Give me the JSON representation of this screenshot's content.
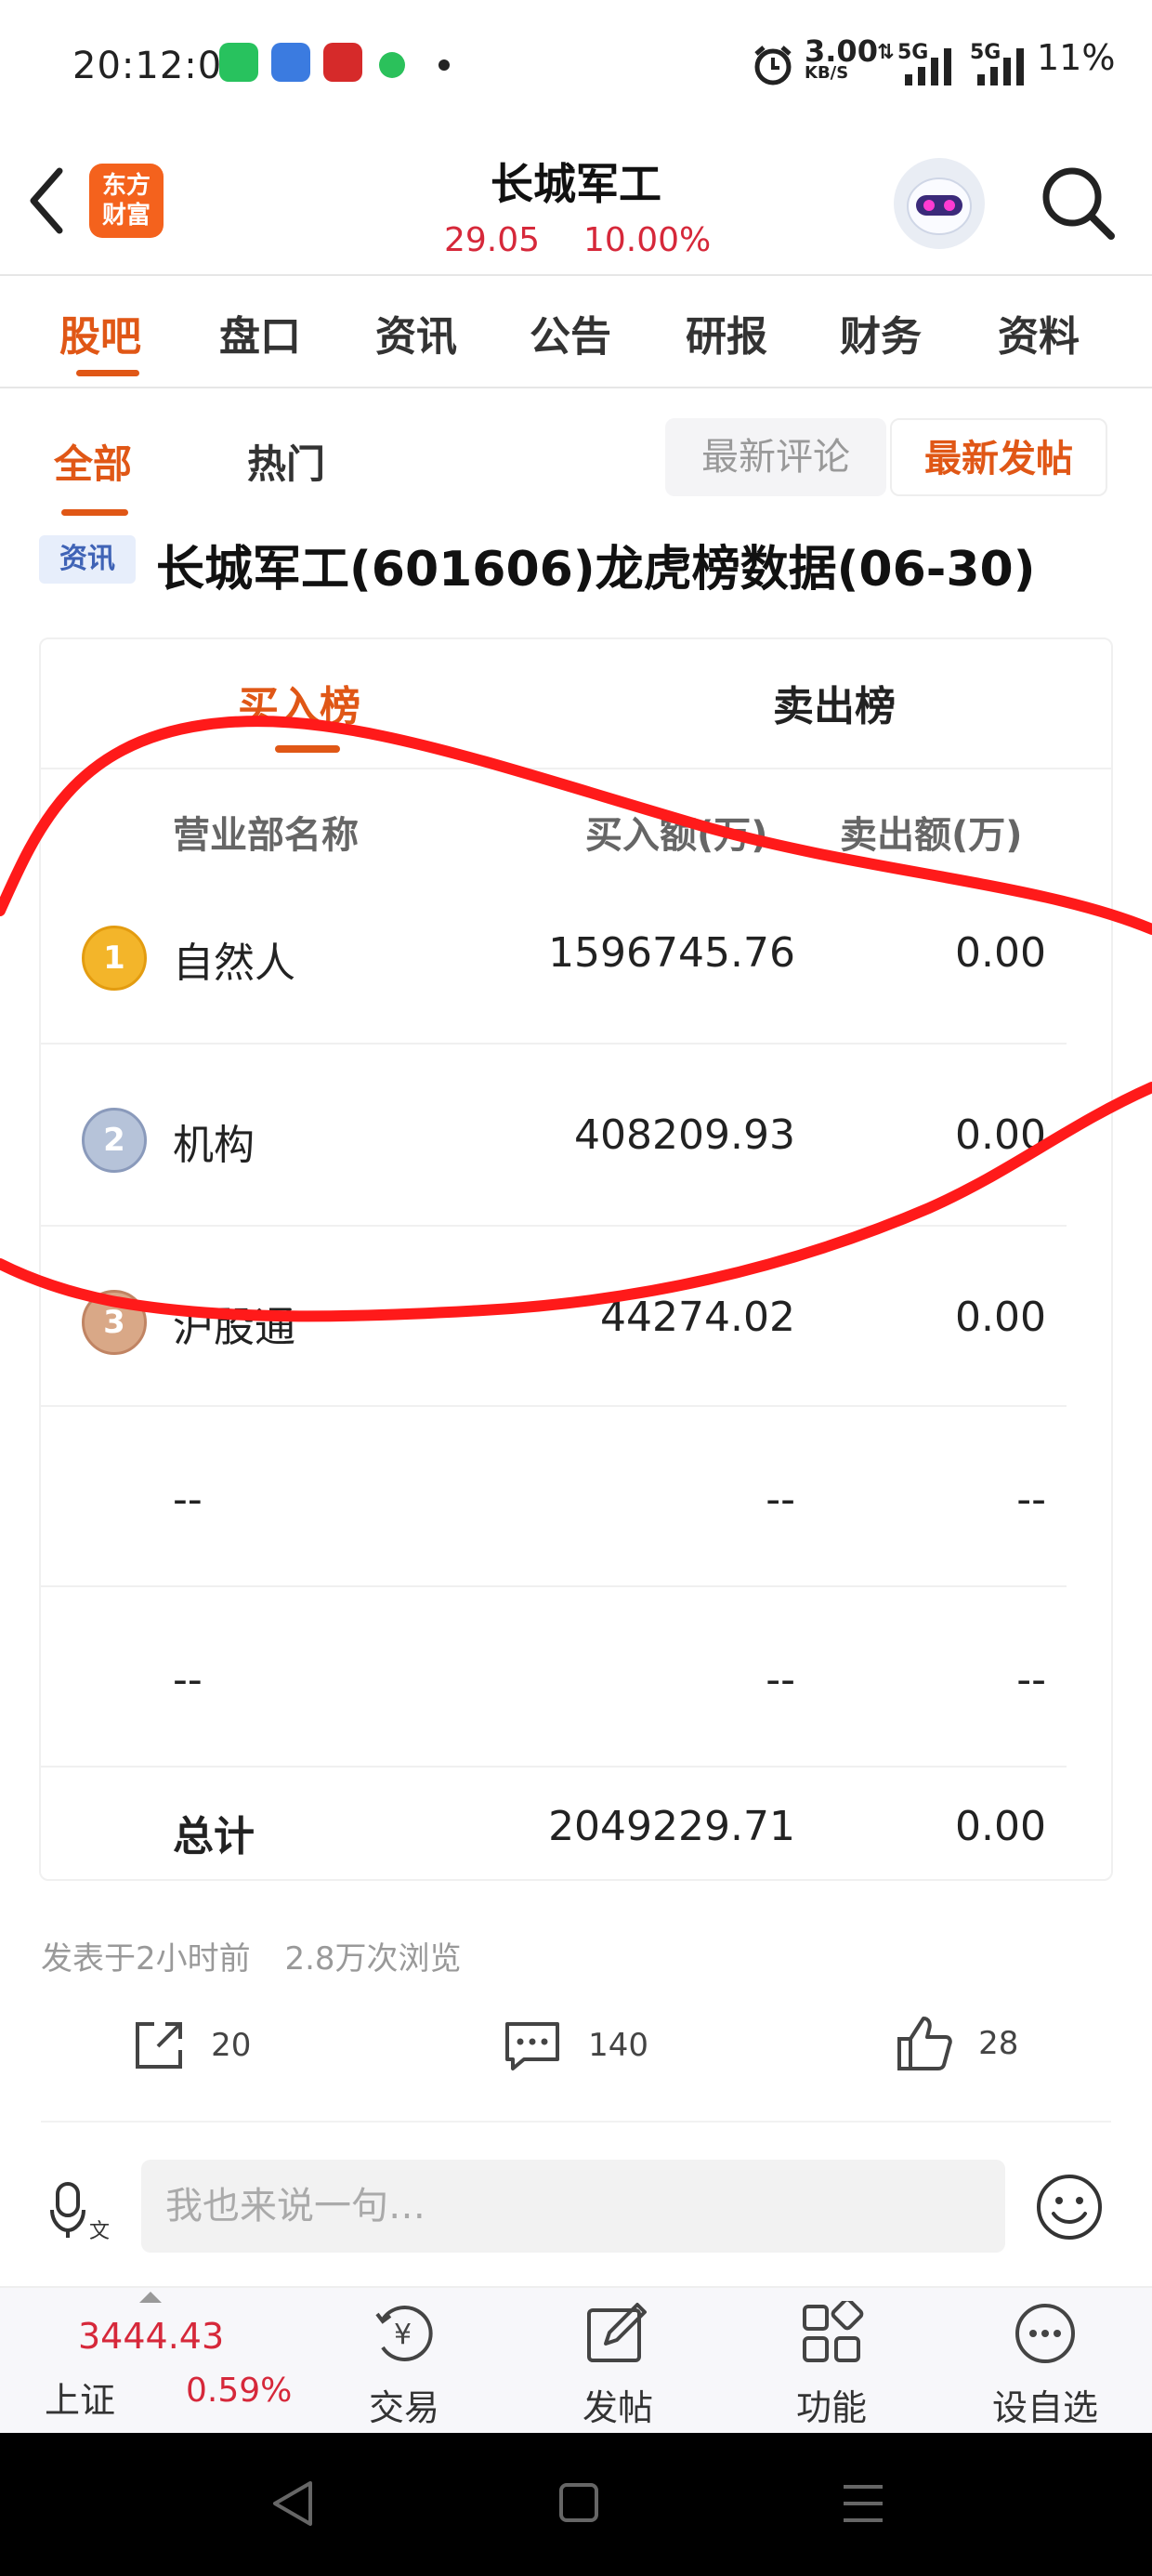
{
  "status_bar": {
    "time": "20:12:06",
    "speed_value": "3.00",
    "speed_unit": "KB/S",
    "net1": "5G",
    "net2": "5G",
    "battery": "11%"
  },
  "header": {
    "logo_line1": "东方",
    "logo_line2": "财富",
    "stock_name": "长城军工",
    "price": "29.05",
    "change_pct": "10.00%"
  },
  "main_tabs": [
    {
      "label": "股吧"
    },
    {
      "label": "盘口"
    },
    {
      "label": "资讯"
    },
    {
      "label": "公告"
    },
    {
      "label": "研报"
    },
    {
      "label": "财务"
    },
    {
      "label": "资料"
    }
  ],
  "sub_tabs": {
    "all": "全部",
    "hot": "热门",
    "sort_latest_comment": "最新评论",
    "sort_latest_post": "最新发帖"
  },
  "post": {
    "tag": "资讯",
    "title": "长城军工(601606)龙虎榜数据(06-30)",
    "card_tabs": {
      "buy": "买入榜",
      "sell": "卖出榜"
    },
    "columns": {
      "dept": "营业部名称",
      "buy": "买入额(万)",
      "sell": "卖出额(万)"
    },
    "rows": [
      {
        "rank": "1",
        "dept": "自然人",
        "buy": "1596745.76",
        "sell": "0.00"
      },
      {
        "rank": "2",
        "dept": "机构",
        "buy": "408209.93",
        "sell": "0.00"
      },
      {
        "rank": "3",
        "dept": "沪股通",
        "buy": "44274.02",
        "sell": "0.00"
      },
      {
        "rank": "",
        "dept": "--",
        "buy": "--",
        "sell": "--"
      },
      {
        "rank": "",
        "dept": "--",
        "buy": "--",
        "sell": "--"
      }
    ],
    "total": {
      "label": "总计",
      "buy": "2049229.71",
      "sell": "0.00"
    },
    "meta_time": "发表于2小时前",
    "meta_views": "2.8万次浏览",
    "shares": "20",
    "comments": "140",
    "likes": "28"
  },
  "comment_bar": {
    "placeholder": "我也来说一句…"
  },
  "bottom_nav": {
    "index_value": "3444.43",
    "index_name": "上证",
    "index_pct": "0.59%",
    "items": [
      {
        "label": "交易"
      },
      {
        "label": "发帖"
      },
      {
        "label": "功能"
      },
      {
        "label": "设自选"
      }
    ]
  },
  "colors": {
    "accent": "#e05716",
    "up_red": "#d6283a",
    "annotation_red": "#ff1a1a",
    "news_tag_blue": "#3f63b6"
  },
  "icons": [
    "back-icon",
    "search-icon",
    "robot-avatar-icon",
    "share-icon",
    "comment-icon",
    "like-icon",
    "voice-icon",
    "emoji-icon",
    "trade-icon",
    "post-icon",
    "function-icon",
    "watchlist-icon"
  ]
}
